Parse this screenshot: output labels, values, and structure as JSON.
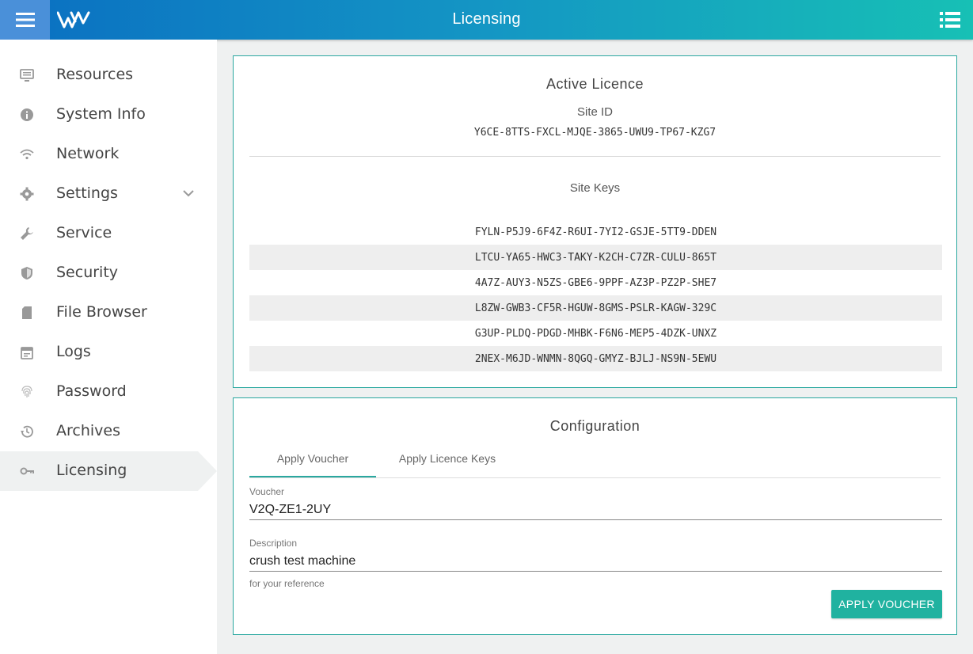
{
  "header": {
    "title": "Licensing",
    "menu_icon": "hamburger-icon",
    "logo": "brand-logo",
    "list_icon": "list-icon",
    "gradient_start": "#0a6fc2",
    "gradient_end": "#17c0b5"
  },
  "sidebar": {
    "items": [
      {
        "label": "Resources",
        "icon": "monitor-icon"
      },
      {
        "label": "System Info",
        "icon": "info-icon"
      },
      {
        "label": "Network",
        "icon": "wifi-icon"
      },
      {
        "label": "Settings",
        "icon": "gear-icon"
      },
      {
        "label": "Service",
        "icon": "wrench-icon"
      },
      {
        "label": "Security",
        "icon": "shield-icon"
      },
      {
        "label": "File Browser",
        "icon": "sd-card-icon"
      },
      {
        "label": "Logs",
        "icon": "calendar-icon"
      },
      {
        "label": "Password",
        "icon": "fingerprint-icon"
      },
      {
        "label": "Archives",
        "icon": "history-icon"
      },
      {
        "label": "Licensing",
        "icon": "key-icon"
      }
    ],
    "active": "Licensing"
  },
  "active_licence": {
    "title": "Active Licence",
    "site_id_label": "Site ID",
    "site_id": "Y6CE-8TTS-FXCL-MJQE-3865-UWU9-TP67-KZG7",
    "site_keys_label": "Site Keys",
    "site_keys": [
      "FYLN-P5J9-6F4Z-R6UI-7YI2-GSJE-5TT9-DDEN",
      "LTCU-YA65-HWC3-TAKY-K2CH-C7ZR-CULU-865T",
      "4A7Z-AUY3-N5ZS-GBE6-9PPF-AZ3P-PZ2P-SHE7",
      "L8ZW-GWB3-CF5R-HGUW-8GMS-PSLR-KAGW-329C",
      "G3UP-PLDQ-PDGD-MHBK-F6N6-MEP5-4DZK-UNXZ",
      "2NEX-M6JD-WNMN-8QGQ-GMYZ-BJLJ-NS9N-5EWU"
    ]
  },
  "configuration": {
    "title": "Configuration",
    "tabs": [
      {
        "label": "Apply Voucher",
        "active": true
      },
      {
        "label": "Apply Licence Keys",
        "active": false
      }
    ],
    "voucher_label": "Voucher",
    "voucher_value": "V2Q-ZE1-2UY",
    "description_label": "Description",
    "description_value": "crush test machine",
    "description_hint": "for your reference",
    "apply_button": "APPLY VOUCHER",
    "accent": "#20b2a0"
  }
}
